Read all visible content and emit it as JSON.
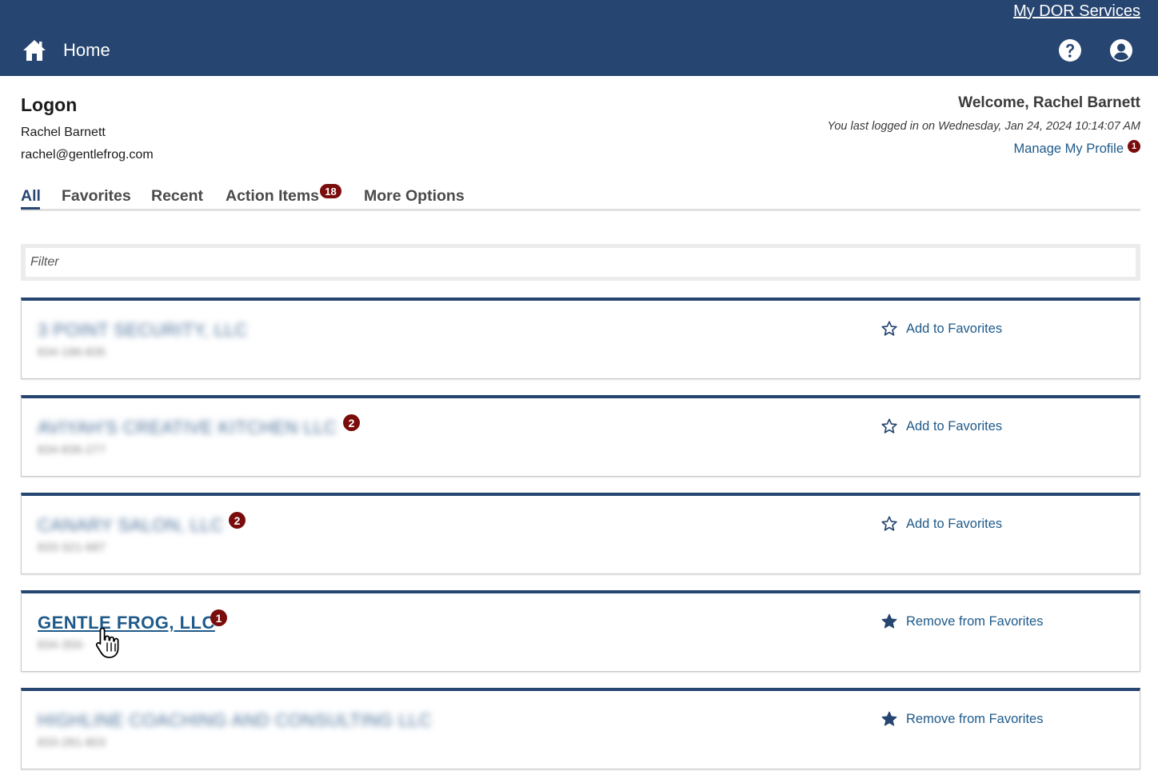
{
  "header": {
    "services_link": "My DOR Services",
    "home_label": "Home"
  },
  "logon": {
    "title": "Logon",
    "name": "Rachel Barnett",
    "email": "rachel@gentlefrog.com"
  },
  "welcome": {
    "greeting": "Welcome, Rachel Barnett",
    "last_login": "You last logged in on Wednesday, Jan 24, 2024 10:14:07 AM",
    "manage_profile": "Manage My Profile",
    "profile_badge": "1"
  },
  "tabs": [
    {
      "label": "All",
      "active": true
    },
    {
      "label": "Favorites"
    },
    {
      "label": "Recent"
    },
    {
      "label": "Action Items",
      "badge": "18"
    },
    {
      "label": "More Options"
    }
  ],
  "filter": {
    "placeholder": "Filter"
  },
  "accounts": [
    {
      "name": "3 POINT SECURITY, LLC",
      "id": "834-186-835",
      "badge": "",
      "favorite_label": "Add to Favorites",
      "favorited": false
    },
    {
      "name": "AVIYAH'S CREATIVE KITCHEN LLC",
      "id": "834-836-277",
      "badge": "2",
      "favorite_label": "Add to Favorites",
      "favorited": false
    },
    {
      "name": "CANARY SALON, LLC",
      "id": "833-321-687",
      "badge": "2",
      "favorite_label": "Add to Favorites",
      "favorited": false
    },
    {
      "name": "GENTLE FROG, LLC",
      "id": "834-359-",
      "badge": "1",
      "favorite_label": "Remove from Favorites",
      "favorited": true
    },
    {
      "name": "HIGHLINE COACHING AND CONSULTING LLC",
      "id": "833-281-803",
      "badge": "",
      "favorite_label": "Remove from Favorites",
      "favorited": true
    }
  ],
  "colors": {
    "header_bg": "#264570",
    "link": "#1f5a8a",
    "badge": "#7a0c0c"
  }
}
